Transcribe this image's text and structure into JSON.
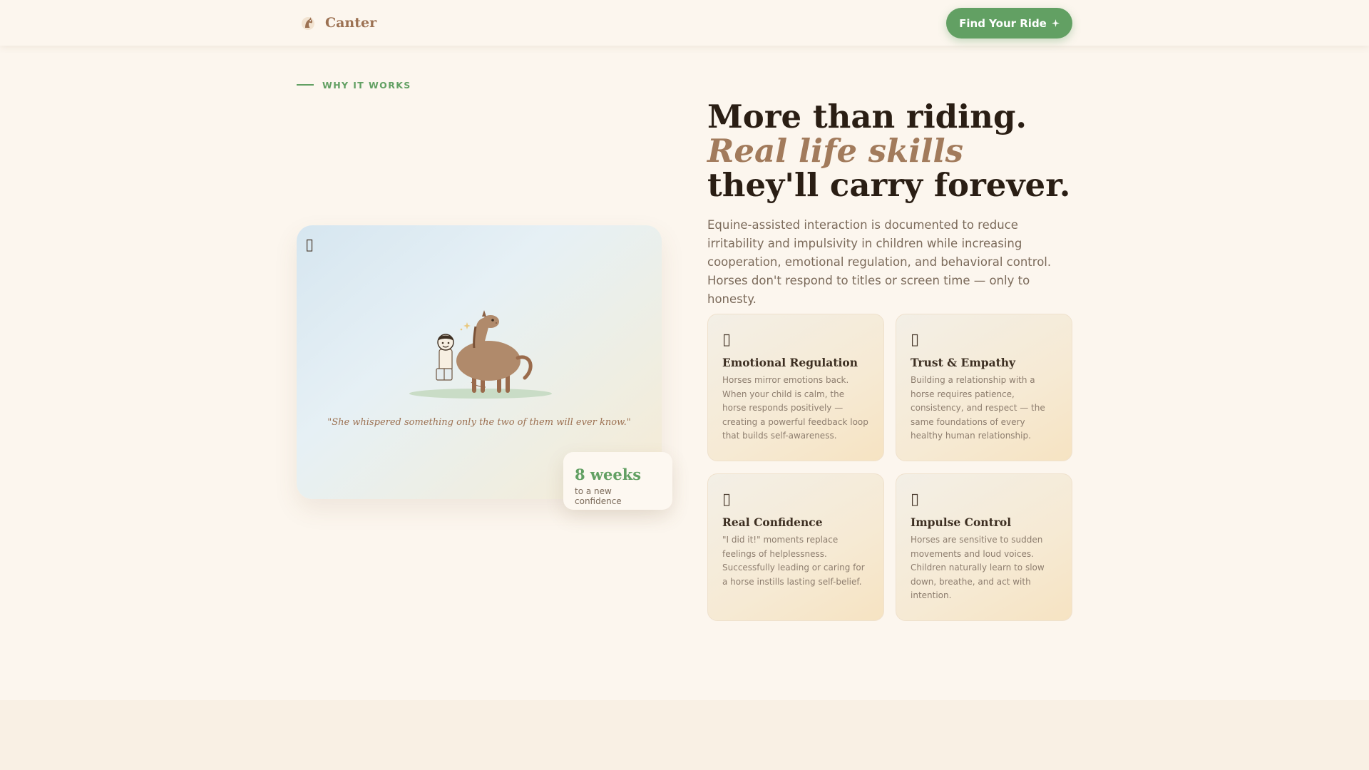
{
  "brand": {
    "name": "Canter",
    "logo_icon": "horse-head-icon"
  },
  "header": {
    "cta_label": "Find Your Ride",
    "cta_icon": "sparkle-icon",
    "cta_color": "#62a063"
  },
  "section": {
    "eyebrow": "WHY IT WORKS",
    "headline_line1": "More than riding.",
    "headline_line2": "Real life skills",
    "headline_line3": "they'll carry forever.",
    "intro": "Equine-assisted interaction is documented to reduce irritability and impulsivity in children while increasing cooperation, emotional regulation, and behavioral control. Horses don't respond to titles or screen time — only to honesty."
  },
  "illustration": {
    "corner_glyph": "▯",
    "quote": "\"She whispered something only the two of them will ever know.\"",
    "stat_number": "8 weeks",
    "stat_label": "to a new confidence"
  },
  "features": [
    {
      "glyph": "▯",
      "title": "Emotional Regulation",
      "description": "Horses mirror emotions back. When your child is calm, the horse responds positively — creating a powerful feedback loop that builds self-awareness."
    },
    {
      "glyph": "▯",
      "title": "Trust & Empathy",
      "description": "Building a relationship with a horse requires patience, consistency, and respect — the same foundations of every healthy human relationship."
    },
    {
      "glyph": "▯",
      "title": "Real Confidence",
      "description": "\"I did it!\" moments replace feelings of helplessness. Successfully leading or caring for a horse instills lasting self-belief."
    },
    {
      "glyph": "▯",
      "title": "Impulse Control",
      "description": "Horses are sensitive to sudden movements and loud voices. Children naturally learn to slow down, breathe, and act with intention."
    }
  ],
  "colors": {
    "background": "#fcf6ee",
    "accent_green": "#62a063",
    "accent_brown": "#a27b5c",
    "text_dark": "#2a1e14"
  }
}
